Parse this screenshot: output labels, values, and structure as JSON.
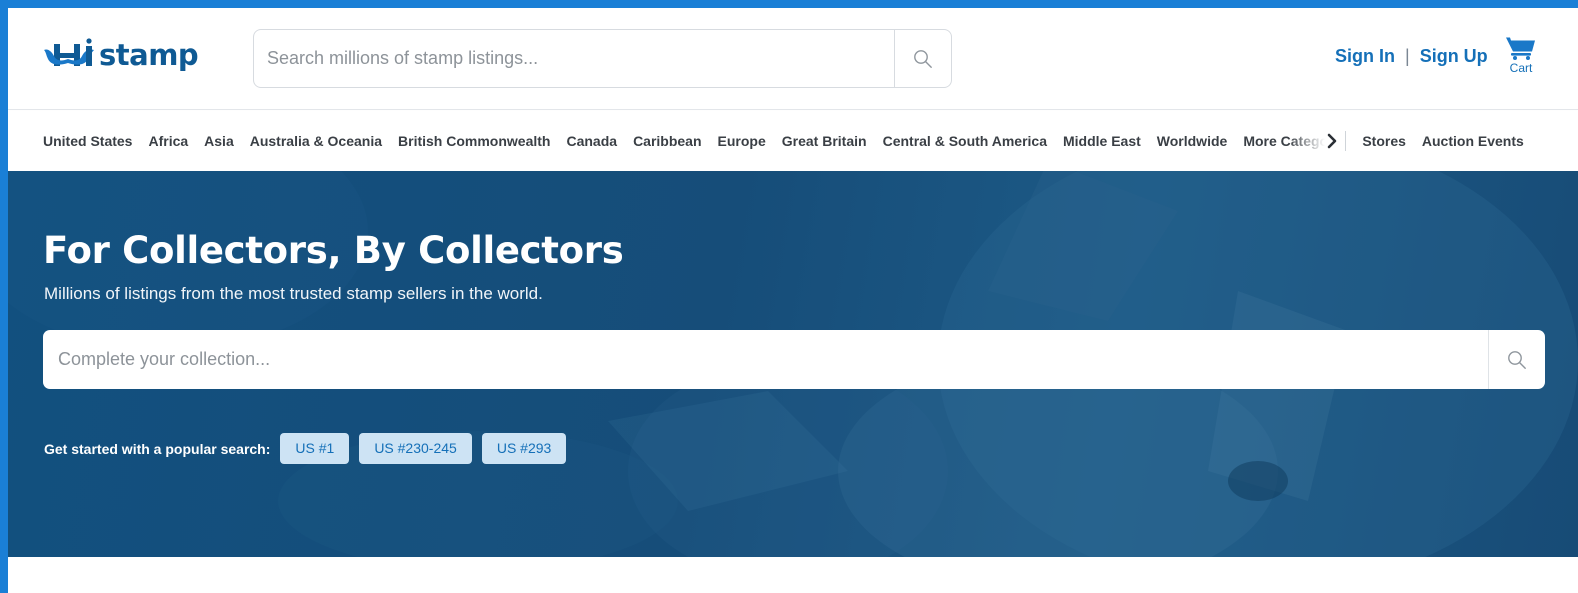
{
  "brand": {
    "name": "HipStamp",
    "logo_text": "stamp",
    "logo_color": "#0f5a94"
  },
  "header": {
    "search_placeholder": "Search millions of stamp listings...",
    "sign_in": "Sign In",
    "separator": "|",
    "sign_up": "Sign Up",
    "cart_label": "Cart"
  },
  "nav": {
    "items": [
      {
        "label": "United States"
      },
      {
        "label": "Africa"
      },
      {
        "label": "Asia"
      },
      {
        "label": "Australia & Oceania"
      },
      {
        "label": "British Commonwealth"
      },
      {
        "label": "Canada"
      },
      {
        "label": "Caribbean"
      },
      {
        "label": "Europe"
      },
      {
        "label": "Great Britain"
      },
      {
        "label": "Central & South America"
      },
      {
        "label": "Middle East"
      },
      {
        "label": "Worldwide"
      }
    ],
    "more_label": "More Categories",
    "stores": "Stores",
    "auction_events": "Auction Events"
  },
  "hero": {
    "title": "For Collectors, By Collectors",
    "subtitle": "Millions of listings from the most trusted stamp sellers in the world.",
    "search_placeholder": "Complete your collection...",
    "popular_label": "Get started with a popular search:",
    "chips": [
      {
        "label": "US #1"
      },
      {
        "label": "US #230-245"
      },
      {
        "label": "US #293"
      }
    ]
  },
  "colors": {
    "frame": "#1a7fd6",
    "accent": "#1570b8",
    "hero_bg": "#164d79",
    "chip_bg": "#cde3f4"
  },
  "icons": {
    "search": "search-icon",
    "cart": "cart-icon",
    "chevron": "chevron-right-icon",
    "logo_mustache": "mustache-logo-icon"
  }
}
